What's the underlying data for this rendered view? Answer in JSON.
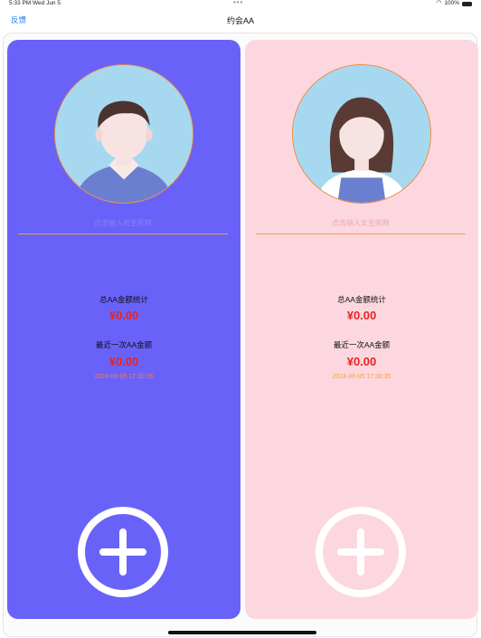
{
  "status": {
    "time": "5:33 PM  Wed Jun 5",
    "dots": "•••",
    "battery": "100%"
  },
  "nav": {
    "back_label": "反馈",
    "title": "约会AA"
  },
  "male": {
    "placeholder": "点击输入男生昵称",
    "total_label": "总AA金额统计",
    "total_amount": "¥0.00",
    "recent_label": "最近一次AA金额",
    "recent_amount": "¥0.00",
    "timestamp": "2024-06-05 17:30:35"
  },
  "female": {
    "placeholder": "点击输入女生昵称",
    "total_label": "总AA金额统计",
    "total_amount": "¥0.00",
    "recent_label": "最近一次AA金额",
    "recent_amount": "¥0.00",
    "timestamp": "2024-06-05 17:30:35"
  },
  "colors": {
    "male_panel": "#6962f9",
    "female_panel": "#fdd7df",
    "amount": "#e8231f",
    "accent_line": "#f0a23c",
    "link": "#1e7cf2"
  },
  "icons": {
    "male_avatar": "boy-avatar-icon",
    "female_avatar": "girl-avatar-icon",
    "add": "plus-circle-icon"
  }
}
